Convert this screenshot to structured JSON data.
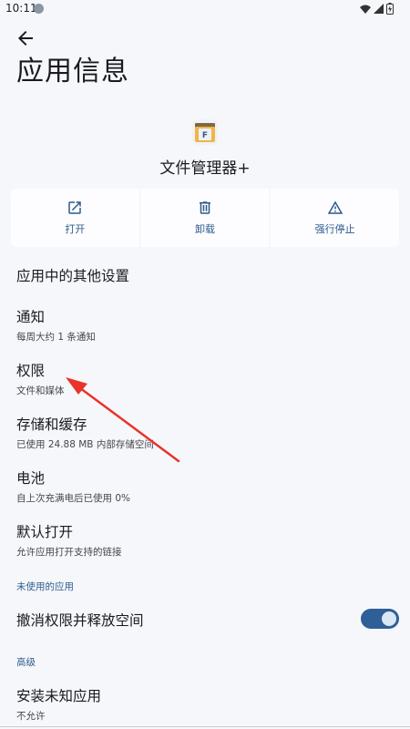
{
  "status_bar": {
    "time": "10:11"
  },
  "header": {
    "title": "应用信息"
  },
  "app": {
    "name": "文件管理器+"
  },
  "actions": [
    {
      "label": "打开",
      "icon": "open-external-icon"
    },
    {
      "label": "卸载",
      "icon": "trash-icon"
    },
    {
      "label": "强行停止",
      "icon": "warning-icon"
    }
  ],
  "settings": {
    "other_settings": "应用中的其他设置",
    "notifications": {
      "title": "通知",
      "subtitle": "每周大约 1 条通知"
    },
    "permissions": {
      "title": "权限",
      "subtitle": "文件和媒体"
    },
    "storage": {
      "title": "存储和缓存",
      "subtitle": "已使用 24.88 MB 内部存储空间"
    },
    "battery": {
      "title": "电池",
      "subtitle": "自上次充满电后已使用 0%"
    },
    "default_open": {
      "title": "默认打开",
      "subtitle": "允许应用打开支持的链接"
    }
  },
  "unused_section": {
    "label": "未使用的应用",
    "revoke_permissions": {
      "title": "撤消权限并释放空间",
      "enabled": true
    }
  },
  "advanced_section": {
    "label": "高级",
    "install_unknown": {
      "title": "安装未知应用",
      "subtitle": "不允许"
    }
  },
  "colors": {
    "accent": "#2f5f97",
    "arrow": "#e8342a",
    "background": "#f6f7fb"
  }
}
